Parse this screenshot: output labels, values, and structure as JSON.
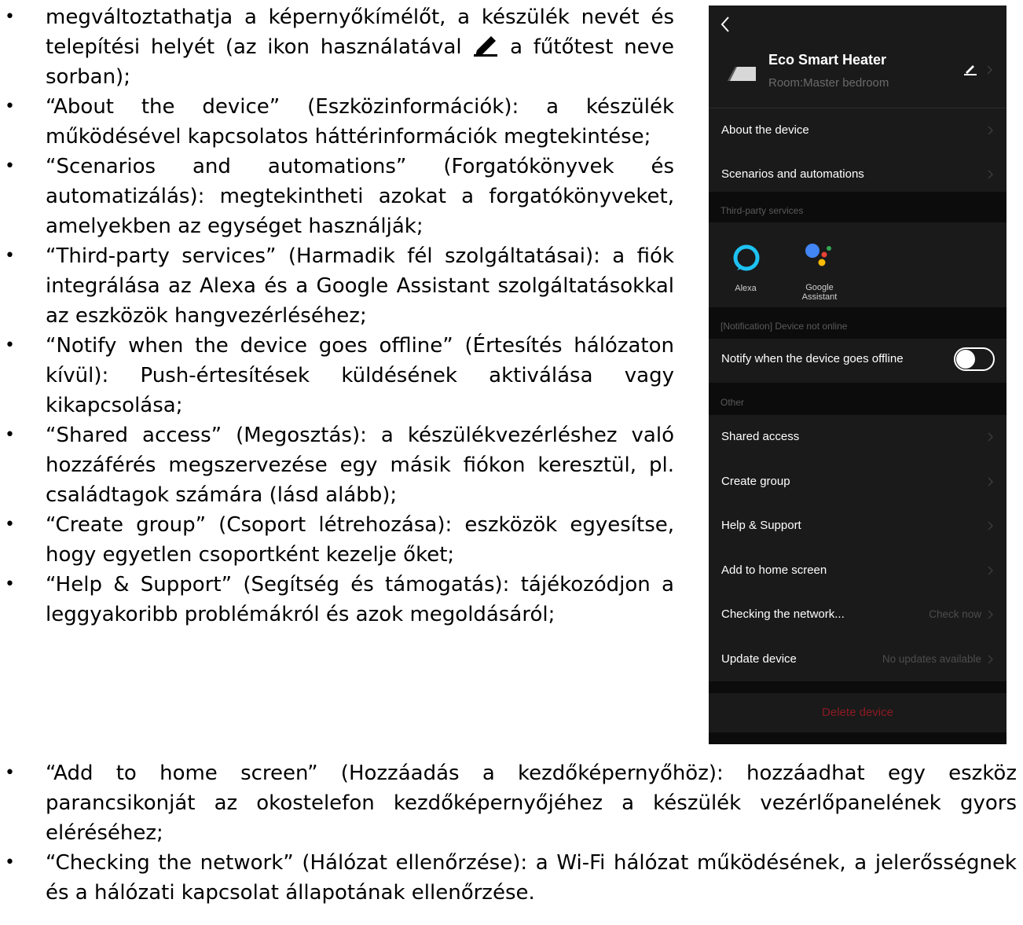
{
  "doc": {
    "top_items": [
      "megváltoztathatja a képernyőkímélőt, a készülék nevét és telepítési helyét (az ikon használatával",
      "“About the device” (Eszközinformációk): a készülék működésével kapcsolatos háttérinformációk megtekintése;",
      "“Scenarios and automations” (Forgatókönyvek és automatizálás): megtekintheti azokat a forgatókönyveket, amelyekben az egységet használják;",
      "“Third-party services” (Harmadik fél szolgáltatásai): a fiók integrálása az Alexa és a Google Assistant szolgáltatásokkal az eszközök hangvezérléséhez;",
      "“Notify when the device goes offline” (Értesítés hálózaton kívül): Push-értesítések küldésének aktiválása vagy kikapcsolása;",
      "“Shared access” (Megosztás): a készülékvezérléshez való hozzáférés megszervezése egy másik fiókon keresztül, pl. családtagok számára (lásd alább);",
      "“Create group” (Csoport létrehozása): eszközök egyesítse, hogy egyetlen csoportként kezelje őket;",
      "“Help & Support” (Segítség és támogatás): tájékozódjon a leggyakoribb problémákról és azok megoldásáról;"
    ],
    "first_item_tail": "a fűtőtest neve sorban);",
    "bottom_items": [
      "“Add to home screen” (Hozzáadás a kezdőképernyőhöz): hozzáadhat egy eszköz parancsikonját az okostelefon kezdőképernyőjéhez a készülék vezérlőpanelének gyors eléréséhez;",
      "“Checking the network” (Hálózat ellenőrzése): a Wi-Fi hálózat működésének, a jelerősségnek és a hálózati kapcsolat állapotának ellenőrzése."
    ]
  },
  "phone": {
    "device_name": "Eco Smart Heater",
    "room": "Room:Master bedroom",
    "rows_a": [
      "About the device",
      "Scenarios and automations"
    ],
    "third_party_title": "Third-party services",
    "services": [
      "Alexa",
      "Google\nAssistant"
    ],
    "notification_title": "[Notification] Device not online",
    "notify_label": "Notify when the device goes offline",
    "notify_on": false,
    "other_title": "Other",
    "rows_b": [
      "Shared access",
      "Create group",
      "Help & Support",
      "Add to home screen",
      "Checking the network...",
      "Update device"
    ],
    "check_now": "Check now",
    "no_updates": "No updates available",
    "delete_label": "Delete device",
    "colors": {
      "bg": "#1a1a1a",
      "section_bg": "#0c0c0c",
      "delete": "#8b1a22",
      "alexa": "#1ec2f3"
    },
    "icons": [
      "back-chevron-icon",
      "edit-pencil-icon",
      "chevron-right-icon",
      "alexa-icon",
      "google-assistant-icon"
    ]
  }
}
